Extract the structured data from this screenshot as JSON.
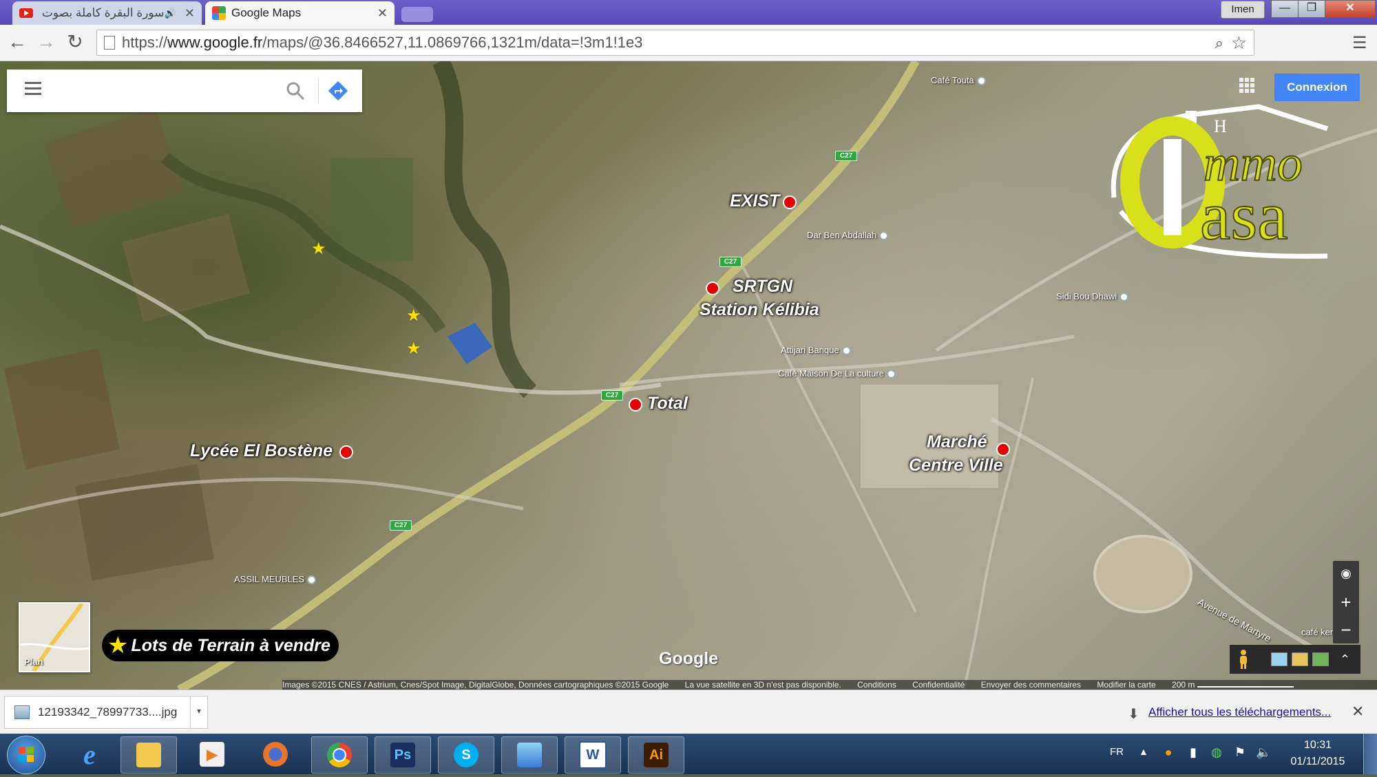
{
  "browser": {
    "tabs": [
      {
        "title": "سورة البقرة كاملة بصوت القار",
        "icon": "youtube-icon"
      },
      {
        "title": "Google Maps",
        "icon": "google-maps-icon"
      }
    ],
    "user": "Imen",
    "url_scheme": "https://",
    "url_host": "www.google.fr",
    "url_path": "/maps/@36.8466527,11.0869766,1321m/data=!3m1!1e3"
  },
  "maps": {
    "search_placeholder": "",
    "connexion_label": "Connexion",
    "plan_label": "Plan",
    "google_logo": "Google",
    "legend_text": "Lots de Terrain à vendre",
    "markers": [
      {
        "id": "exist",
        "label": "EXIST"
      },
      {
        "id": "srtgn",
        "label_line1": "SRTGN",
        "label_line2": "Station Kélibia"
      },
      {
        "id": "total",
        "label": "Total"
      },
      {
        "id": "lycee",
        "label": "Lycée El Bostène"
      },
      {
        "id": "marche",
        "label_line1": "Marché",
        "label_line2": "Centre Ville"
      }
    ],
    "road_badge": "C27",
    "pois": [
      {
        "name": "Café Touta"
      },
      {
        "name": "Dar Ben Abdallah"
      },
      {
        "name": "Sidi Bou Dhawi"
      },
      {
        "name": "Attijari Banque"
      },
      {
        "name": "Café Maison De La culture"
      },
      {
        "name": "ASSIL MEUBLES"
      },
      {
        "name": "café kena"
      }
    ],
    "streets": [
      {
        "name": "Avenue de Martyre"
      }
    ],
    "attribution": [
      "Images ©2015 CNES / Astrium, Cnes/Spot Image, DigitalGlobe, Données cartographiques ©2015 Google",
      "La vue satellite en 3D n'est pas disponible.",
      "Conditions",
      "Confidentialité",
      "Envoyer des commentaires",
      "Modifier la carte"
    ],
    "scale_label": "200 m",
    "logo": {
      "top": "mmo",
      "bottom": "asa",
      "roof_letter": "H"
    }
  },
  "downloads": {
    "file_name": "12193342_78997733....jpg",
    "show_all": "Afficher tous les téléchargements..."
  },
  "taskbar": {
    "apps": [
      {
        "name": "internet-explorer"
      },
      {
        "name": "file-explorer"
      },
      {
        "name": "media-player"
      },
      {
        "name": "firefox"
      },
      {
        "name": "chrome"
      },
      {
        "name": "photoshop",
        "glyph": "Ps"
      },
      {
        "name": "skype",
        "glyph": "S"
      },
      {
        "name": "picture-viewer"
      },
      {
        "name": "word",
        "glyph": "W"
      },
      {
        "name": "illustrator",
        "glyph": "Ai"
      }
    ],
    "lang": "FR",
    "time": "10:31",
    "date": "01/11/2015"
  },
  "colors": {
    "marker": "#e60000",
    "star": "#ffe100",
    "connexion": "#4285f4",
    "road": "#c9c27a",
    "road_badge": "#2fa73f",
    "logo_yellow": "#d8e01a"
  }
}
